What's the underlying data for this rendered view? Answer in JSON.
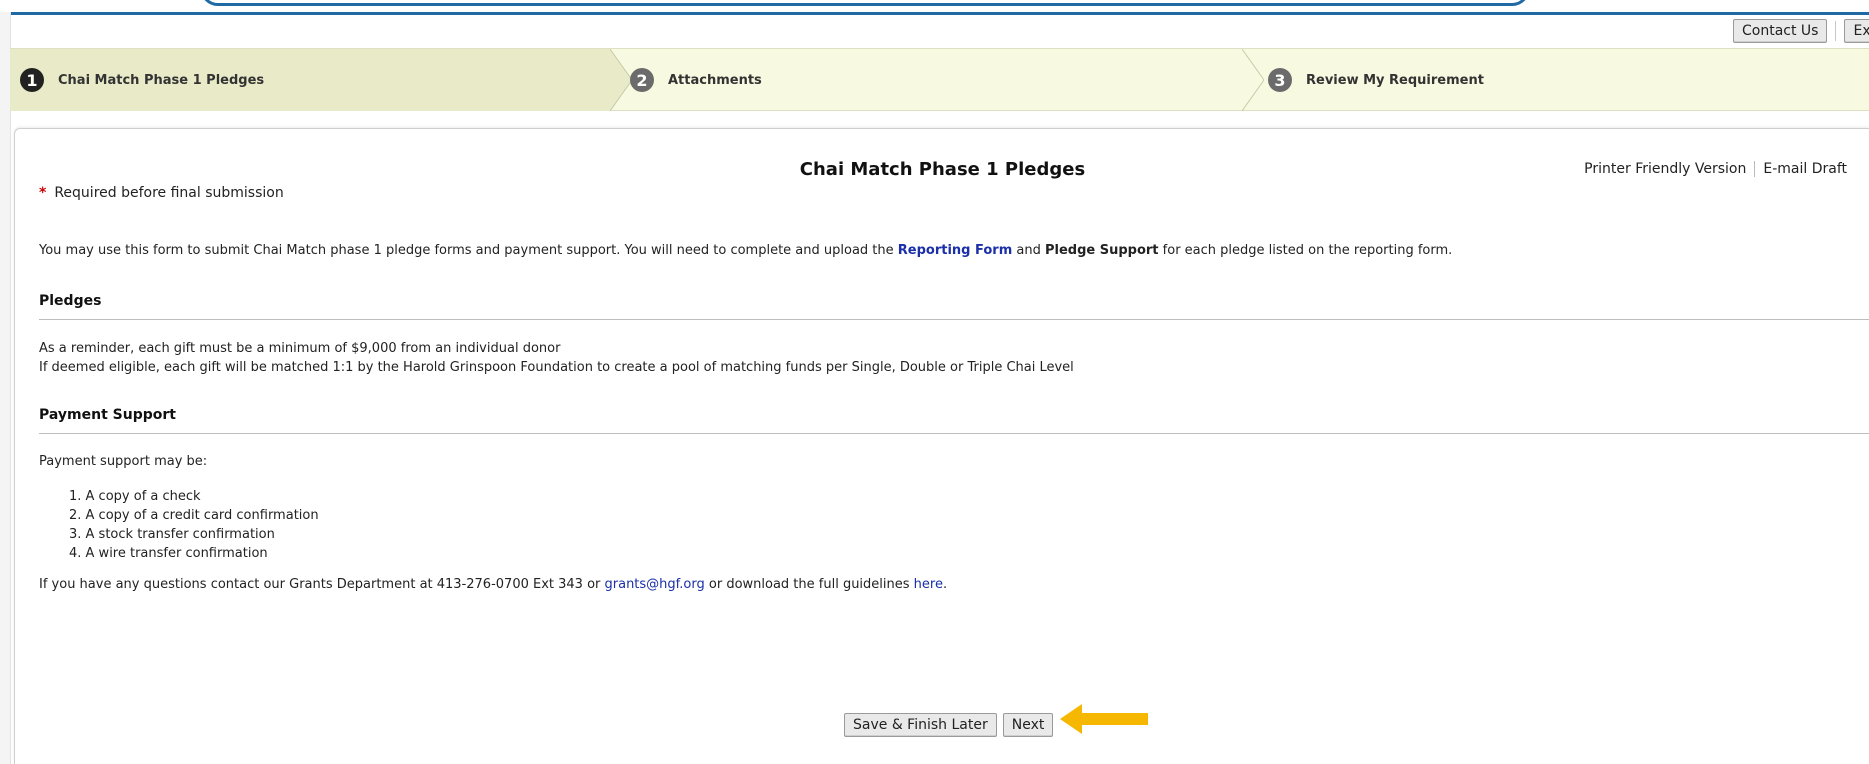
{
  "header": {
    "contact_label": "Contact Us",
    "exit_label": "Exit"
  },
  "wizard": {
    "steps": [
      {
        "number": "1",
        "label": "Chai Match Phase 1 Pledges",
        "active": true
      },
      {
        "number": "2",
        "label": "Attachments",
        "active": false
      },
      {
        "number": "3",
        "label": "Review My Requirement",
        "active": false
      }
    ]
  },
  "page": {
    "title": "Chai Match Phase 1 Pledges",
    "printer_link": "Printer Friendly Version",
    "email_link": "E-mail Draft",
    "required_star": "*",
    "required_note": "Required before final submission",
    "intro_before": "You may use this form to submit Chai Match phase 1 pledge forms and payment support. You will need to complete and upload the ",
    "intro_link": "Reporting Form",
    "intro_mid": " and ",
    "intro_bold": "Pledge Support",
    "intro_after": " for each pledge listed on the reporting form."
  },
  "pledges": {
    "heading": "Pledges",
    "line1": "As a reminder, each gift must be a minimum of $9,000 from an individual donor",
    "line2": "If deemed eligible, each gift will be matched 1:1 by the Harold Grinspoon Foundation to create a pool of matching funds per Single, Double or Triple Chai Level"
  },
  "payment": {
    "heading": "Payment Support",
    "intro": "Payment support may be:",
    "items": [
      "1. A copy of a check",
      "2. A copy of a credit card confirmation",
      "3. A stock transfer confirmation",
      "4. A wire transfer confirmation"
    ],
    "contact_before": "If you have any questions contact our Grants Department at 413-276-0700 Ext 343 or ",
    "contact_email": "grants@hgf.org",
    "contact_mid": " or download the full guidelines ",
    "contact_here": "here",
    "contact_end": "."
  },
  "footer": {
    "save_label": "Save & Finish Later",
    "next_label": "Next"
  },
  "colors": {
    "accent_blue": "#1f6aa5",
    "wizard_bg": "#f8f9e1",
    "arrow_color": "#f5b700",
    "link_blue": "#1a2fa8"
  },
  "icons": {
    "arrow": "left-arrow-icon"
  }
}
